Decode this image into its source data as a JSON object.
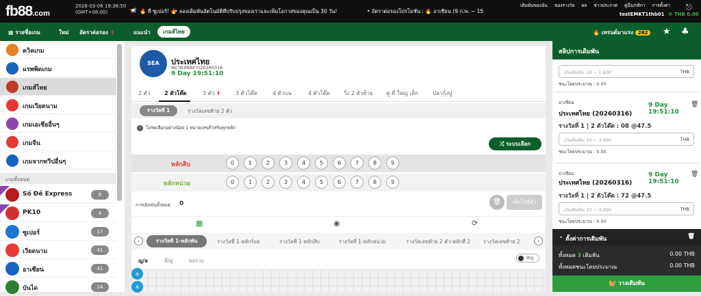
{
  "header": {
    "logo_main": "fb88",
    "logo_suffix": ".com",
    "date": "2026-03-06 19:38:50",
    "timezone": "(GMT+08:00)",
    "promo_1": "🔥 ที่ ซูเปอร์! 🔥",
    "promo_2": "• ลองเดิมพันอัตโนมัติที่ปรับปรุงของเราและเพิ่มโอกาสของคุณเป็น 30 วัน!",
    "promo_3": "• อัตราต่อรองโปรโมชั่น : 🔥 อาเซียน (9 ก.พ. ~ 15",
    "links": [
      "เดิมพันของฉัน",
      "ของรางวัล",
      "ผล",
      "ข่าวประกาศ",
      "คู่มือ/กติกา",
      "การตั้งค่า"
    ],
    "username": "testEMKT1thb01",
    "balance": "THB 0.00"
  },
  "nav": {
    "items": [
      "รายชื่อเกม",
      "ใหม่",
      "อัตราต่อรอง",
      "แนะนำ"
    ],
    "active": "เกมส์ไทย",
    "hot_label": "เทรนด์มาแรง",
    "hot_count": "262"
  },
  "sidebar": {
    "categories": [
      {
        "label": "ควิคเกม",
        "color": "#e67e22"
      },
      {
        "label": "แรพพิดเกม",
        "color": "#1565c0"
      },
      {
        "label": "เกมส์ไทย",
        "color": "#c0392b"
      },
      {
        "label": "เกมเวียดนาม",
        "color": "#e53935"
      },
      {
        "label": "เกมเอเชียอื่นๆ",
        "color": "#8e44ad"
      },
      {
        "label": "เกมจีน",
        "color": "#e53935"
      },
      {
        "label": "เกมจากทวีปอื่นๆ",
        "color": "#1565c0"
      }
    ],
    "all_games_label": "เกมทั้งหมด",
    "games": [
      {
        "label": "Số Đề Express",
        "count": "6",
        "color": "#b71c1c"
      },
      {
        "label": "PK10",
        "count": "4",
        "color": "#d32f2f"
      },
      {
        "label": "ซูเปอร์",
        "count": "17",
        "color": "#1976d2"
      },
      {
        "label": "เวียดนาม",
        "count": "41",
        "color": "#e53935"
      },
      {
        "label": "อาเซียน",
        "count": "41",
        "color": "#1565c0"
      },
      {
        "label": "บันได",
        "count": "14",
        "color": "#2e7d32"
      }
    ]
  },
  "main": {
    "logo_text": "SEA",
    "title": "ประเทศไทย",
    "draw_no": "หมายเลขสลาก20260316",
    "countdown": "9 Day 19:51:10",
    "tabs": [
      "2 ตัว",
      "2 ตัวโต๊ด",
      "3 ตัว",
      "3 ตัวโต๊ด",
      "4 ตัวบน",
      "4 ตัวโต๊ด",
      "วิ่ง 2 ตัวท้าย",
      "คู่ คี่ ใหญ่ เล็ก",
      "ปลากุ้งปู"
    ],
    "prize_active": "รางวัลที่ 1",
    "prize_other": "รางวัลเลขท้าย 2 ตัว",
    "info": "โปรดเลือกอย่างน้อย 1 หมายเลขสำหรับทุกหลัก",
    "random_btn": "ระบบเลือก",
    "row1_label": "หลักสิบ",
    "row2_label": "หลักหน่วย",
    "digits": [
      "0",
      "1",
      "2",
      "3",
      "4",
      "5",
      "6",
      "7",
      "8",
      "9"
    ],
    "total_label": "การเดิมพันทั้งหมด:",
    "total_value": "0",
    "add_label": "เพิ่มไปที่ตั๋ว",
    "result_tabs": [
      "รางวัลที่ 1-หลักพัน",
      "รางวัลที่ 1-หลักร้อย",
      "รางวัลที่ 1-หลักสิบ",
      "รางวัลที่ 1-หลักหน่วย",
      "รางวัลเลขท้าย 2 ตัว-หลักที่ 2",
      "รางวัลเลขท้าย 2"
    ],
    "sub_tabs": [
      "ญ/ล",
      "คี่/คู่",
      "ผลรวม"
    ],
    "toggle_label": "Big",
    "ball_label": "a"
  },
  "slip": {
    "title": "สลิปการเดิมพัน",
    "placeholder_1": "เงินเดิมพัน: 10 ~ 1,600",
    "placeholder_2": "เงินเดิมพัน: 10 ~ 3,000",
    "currency": "THB",
    "est_label": "ชนะโดยประมาณ : 0.00",
    "cards": [
      {
        "region": "อาเซียน",
        "time": "9 Day 19:51:10",
        "title": "ประเทศไทย (20260316)",
        "bet": "รางวัลที่ 1 | 2 ตัวโต๊ด : 08 @47.5"
      },
      {
        "region": "อาเซียน",
        "time": "9 Day 19:51:10",
        "title": "ประเทศไทย (20260316)",
        "bet": "รางวัลที่ 1 | 2 ตัวโต๊ด : 72 @47.5"
      }
    ],
    "settings_label": "ตั้งค่าการเดิมพัน",
    "total_label": "ทั้งหมด",
    "total_count": "3",
    "total_suffix": "เดิมพัน",
    "total_amount": "0.00 THB",
    "win_label": "ทั้งหมดชนะโดยประมาณ",
    "win_amount": "0.00 THB",
    "place_label": "วางเดิมพัน"
  }
}
